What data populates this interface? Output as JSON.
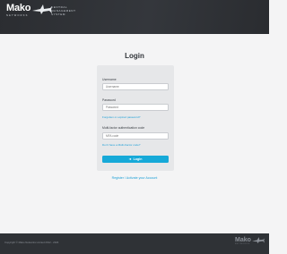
{
  "header": {
    "logo_text": "Mako",
    "logo_sub": "NETWORKS",
    "product_line1": "CENTRAL",
    "product_line2": "MANAGEMENT",
    "product_line3": "SYSTEM"
  },
  "login": {
    "title": "Login",
    "username_label": "Username",
    "username_placeholder": "Username",
    "password_label": "Password",
    "password_placeholder": "Password",
    "forgot_link": "Forgotten or expired password?",
    "mfa_label": "Multi-factor authentication code",
    "mfa_placeholder": "MFA code",
    "no_mfa_link": "Don't have a Multi-Factor code?",
    "login_button": "Login"
  },
  "register_link": "Register / Activate your Account",
  "footer": {
    "copyright": "Copyright © Mako Networks Limited 2012 - 2024",
    "logo_text": "Mako",
    "logo_sub": "NETWORKS"
  },
  "colors": {
    "accent": "#16a9d8",
    "link": "#1a9ed6",
    "header": "#2b2d31",
    "footer": "#2f3236"
  }
}
